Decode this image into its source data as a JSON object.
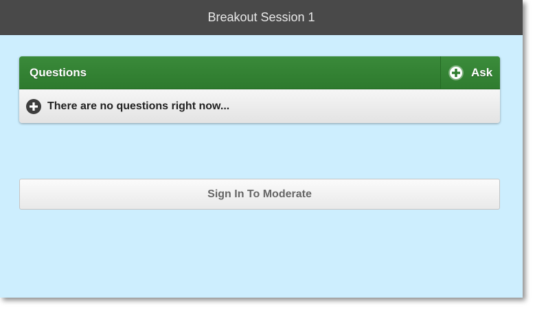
{
  "header": {
    "title": "Breakout Session 1"
  },
  "questions_panel": {
    "title": "Questions",
    "ask_button_label": "Ask",
    "ask_icon": "plus-circle-icon",
    "empty_item_icon": "plus-circle-icon",
    "empty_message": "There are no questions right now..."
  },
  "actions": {
    "moderate_label": "Sign In To Moderate"
  },
  "colors": {
    "header_bg": "#494949",
    "page_bg": "#cdeefe",
    "panel_header_green": "#2f7c2f",
    "list_item_bg": "#ececec"
  }
}
